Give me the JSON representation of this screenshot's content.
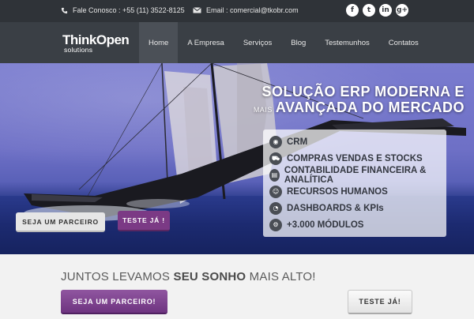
{
  "topbar": {
    "phone": "Fale Conosco : +55 (11) 3522-8125",
    "email": "Email : comercial@tkobr.com",
    "socials": [
      {
        "icon": "facebook-icon",
        "glyph": "f"
      },
      {
        "icon": "twitter-icon",
        "glyph": "t"
      },
      {
        "icon": "linkedin-icon",
        "glyph": "in"
      },
      {
        "icon": "google-plus-icon",
        "glyph": "g+"
      }
    ]
  },
  "logo": {
    "brand_think": "Think",
    "brand_open": "Open",
    "sub": "solutions"
  },
  "nav": {
    "items": [
      "Home",
      "A Empresa",
      "Serviços",
      "Blog",
      "Testemunhos",
      "Contatos"
    ],
    "active": "Home"
  },
  "hero": {
    "headline_line1": "SOLUÇÃO ERP MODERNA E",
    "headline_mais": "MAIS",
    "headline_line2": "AVANÇADA DO MERCADO",
    "features": [
      {
        "icon": "eye-icon",
        "glyph": "◉",
        "label": "CRM"
      },
      {
        "icon": "cart-icon",
        "glyph": "⛟",
        "label": "COMPRAS VENDAS E STOCKS"
      },
      {
        "icon": "chart-icon",
        "glyph": "▤",
        "label": "CONTABILIDADE FINANCEIRA & ANALÍTICA"
      },
      {
        "icon": "users-icon",
        "glyph": "☺",
        "label": "RECURSOS HUMANOS"
      },
      {
        "icon": "dashboard-icon",
        "glyph": "◔",
        "label": "DASHBOARDS & KPIs"
      },
      {
        "icon": "cogs-icon",
        "glyph": "⚙",
        "label": "+3.000 MÓDULOS"
      }
    ],
    "btn_parceiro": "SEJA UM PARCEIRO",
    "btn_teste": "TESTE JÁ !"
  },
  "cta": {
    "title_pre": "JUNTOS LEVAMOS ",
    "title_bold": "SEU SONHO",
    "title_post": " MAIS ALTO!",
    "btn_parceiro": "SEJA UM PARCEIRO!",
    "btn_teste": "TESTE JÁ!"
  }
}
